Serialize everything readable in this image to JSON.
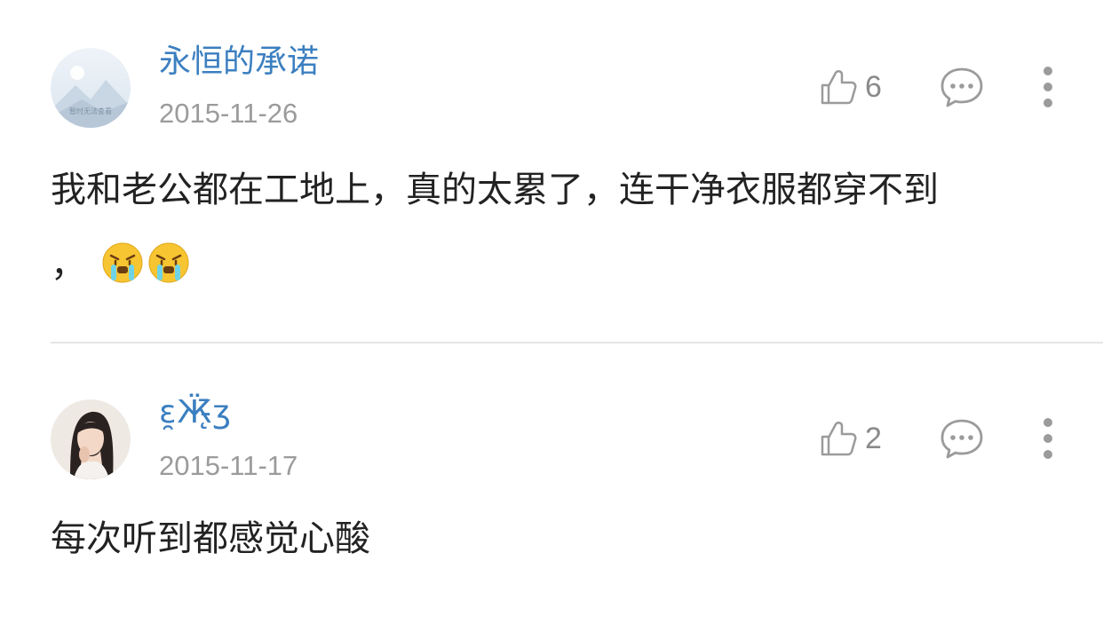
{
  "comments": [
    {
      "username": "永恒的承诺",
      "date": "2015-11-26",
      "likes": "6",
      "avatar_text": "暂时无法查看",
      "content_line1": "我和老公都在工地上，真的太累了，连干净衣服都穿不到",
      "content_line2": "，",
      "emojis": [
        "crying-emoji",
        "crying-emoji"
      ]
    },
    {
      "username": "ɛ̯Ӝ̵̨̄ʒ",
      "date": "2015-11-17",
      "likes": "2",
      "content_line1": "每次听到都感觉心酸"
    }
  ],
  "colors": {
    "username": "#3b7fc0",
    "date": "#9b9b9b",
    "icon": "#9b9b9b",
    "divider": "#e5e5e5"
  }
}
